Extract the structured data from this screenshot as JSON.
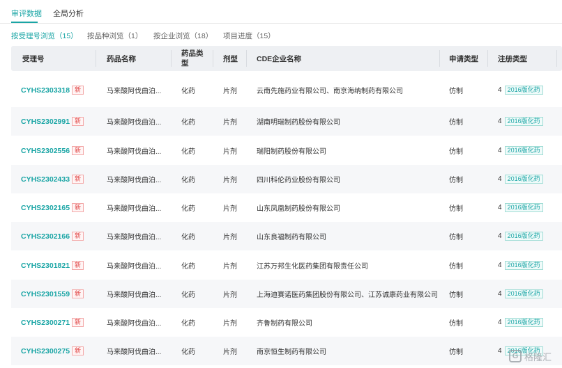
{
  "top_tabs": [
    {
      "label": "审评数据",
      "active": true
    },
    {
      "label": "全局分析",
      "active": false
    }
  ],
  "sub_tabs": [
    {
      "label": "按受理号浏览（15）",
      "active": true
    },
    {
      "label": "按品种浏览（1）",
      "active": false
    },
    {
      "label": "按企业浏览（18）",
      "active": false
    },
    {
      "label": "项目进度（15）",
      "active": false
    }
  ],
  "table": {
    "headers": [
      "受理号",
      "药品名称",
      "药品类型",
      "剂型",
      "CDE企业名称",
      "申请类型",
      "注册类型"
    ],
    "rows": [
      {
        "accept_no": "CYHS2303318",
        "badge": "新",
        "drug_name": "马来酸阿伐曲泊...",
        "drug_type": "化药",
        "dosage": "片剂",
        "company": "云南先施药业有限公司、南京海纳制药有限公司",
        "apply_type": "仿制",
        "reg_num": "4",
        "reg_badge": "2016版化药"
      },
      {
        "accept_no": "CYHS2302991",
        "badge": "新",
        "drug_name": "马来酸阿伐曲泊...",
        "drug_type": "化药",
        "dosage": "片剂",
        "company": "湖南明瑞制药股份有限公司",
        "apply_type": "仿制",
        "reg_num": "4",
        "reg_badge": "2016版化药"
      },
      {
        "accept_no": "CYHS2302556",
        "badge": "新",
        "drug_name": "马来酸阿伐曲泊...",
        "drug_type": "化药",
        "dosage": "片剂",
        "company": "瑞阳制药股份有限公司",
        "apply_type": "仿制",
        "reg_num": "4",
        "reg_badge": "2016版化药"
      },
      {
        "accept_no": "CYHS2302433",
        "badge": "新",
        "drug_name": "马来酸阿伐曲泊...",
        "drug_type": "化药",
        "dosage": "片剂",
        "company": "四川科伦药业股份有限公司",
        "apply_type": "仿制",
        "reg_num": "4",
        "reg_badge": "2016版化药"
      },
      {
        "accept_no": "CYHS2302165",
        "badge": "新",
        "drug_name": "马来酸阿伐曲泊...",
        "drug_type": "化药",
        "dosage": "片剂",
        "company": "山东凤凰制药股份有限公司",
        "apply_type": "仿制",
        "reg_num": "4",
        "reg_badge": "2016版化药"
      },
      {
        "accept_no": "CYHS2302166",
        "badge": "新",
        "drug_name": "马来酸阿伐曲泊...",
        "drug_type": "化药",
        "dosage": "片剂",
        "company": "山东良福制药有限公司",
        "apply_type": "仿制",
        "reg_num": "4",
        "reg_badge": "2016版化药"
      },
      {
        "accept_no": "CYHS2301821",
        "badge": "新",
        "drug_name": "马来酸阿伐曲泊...",
        "drug_type": "化药",
        "dosage": "片剂",
        "company": "江苏万邦生化医药集团有限责任公司",
        "apply_type": "仿制",
        "reg_num": "4",
        "reg_badge": "2016版化药"
      },
      {
        "accept_no": "CYHS2301559",
        "badge": "新",
        "drug_name": "马来酸阿伐曲泊...",
        "drug_type": "化药",
        "dosage": "片剂",
        "company": "上海迪赛诺医药集团股份有限公司、江苏诚康药业有限公司",
        "apply_type": "仿制",
        "reg_num": "4",
        "reg_badge": "2016版化药"
      },
      {
        "accept_no": "CYHS2300271",
        "badge": "新",
        "drug_name": "马来酸阿伐曲泊...",
        "drug_type": "化药",
        "dosage": "片剂",
        "company": "齐鲁制药有限公司",
        "apply_type": "仿制",
        "reg_num": "4",
        "reg_badge": "2016版化药"
      },
      {
        "accept_no": "CYHS2300275",
        "badge": "新",
        "drug_name": "马来酸阿伐曲泊...",
        "drug_type": "化药",
        "dosage": "片剂",
        "company": "南京恒生制药有限公司",
        "apply_type": "仿制",
        "reg_num": "4",
        "reg_badge": "2016版化药"
      }
    ]
  },
  "watermark": {
    "logo": "G",
    "text": "格隆汇"
  },
  "colors": {
    "accent": "#1aa5a5",
    "new_badge": "#e04545",
    "header_bg": "#eef0f3"
  }
}
